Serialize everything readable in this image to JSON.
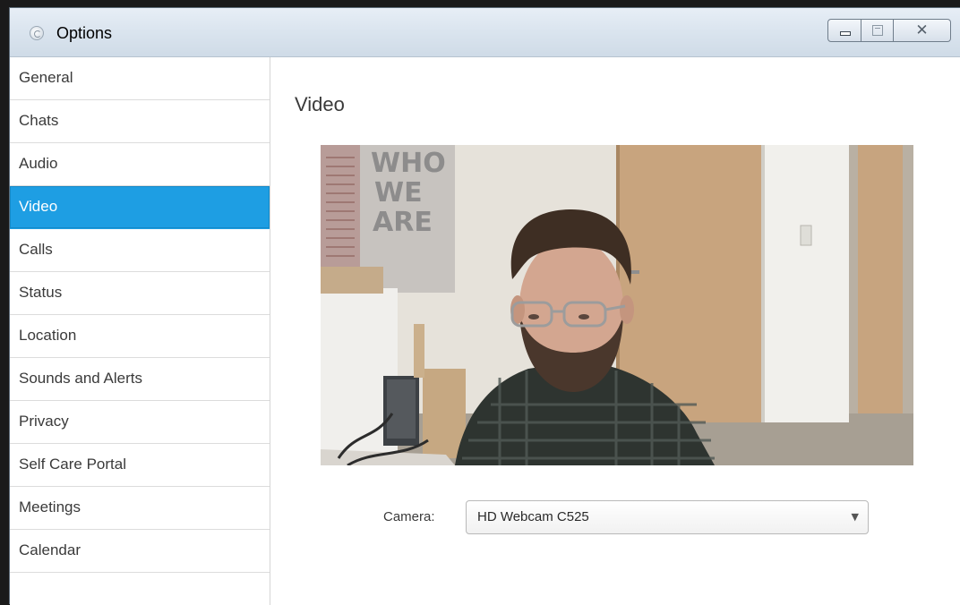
{
  "window": {
    "title": "Options",
    "buttons": {
      "minimize": "minimize-icon",
      "maximize": "maximize-icon",
      "close": "✕"
    }
  },
  "sidebar": {
    "items": [
      {
        "label": "General"
      },
      {
        "label": "Chats"
      },
      {
        "label": "Audio"
      },
      {
        "label": "Video",
        "active": true
      },
      {
        "label": "Calls"
      },
      {
        "label": "Status"
      },
      {
        "label": "Location"
      },
      {
        "label": "Sounds and Alerts"
      },
      {
        "label": "Privacy"
      },
      {
        "label": "Self Care Portal"
      },
      {
        "label": "Meetings"
      },
      {
        "label": "Calendar"
      }
    ]
  },
  "main": {
    "title": "Video",
    "camera": {
      "label": "Camera:",
      "value": "HD Webcam C525"
    }
  },
  "colors": {
    "accent": "#1e9ee3",
    "titlebar": "#dbe5ef"
  },
  "poster_text": [
    "WHO",
    "WE",
    "ARE"
  ]
}
